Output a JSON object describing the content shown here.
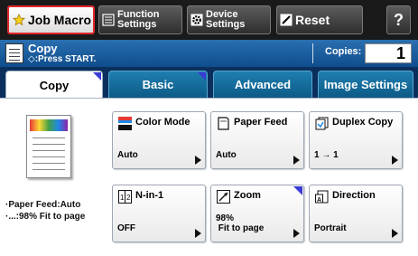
{
  "toolbar": {
    "job_macro": "Job Macro",
    "function_settings": [
      "Function",
      "Settings"
    ],
    "device_settings": [
      "Device",
      "Settings"
    ],
    "reset": "Reset",
    "help": "?"
  },
  "header": {
    "title": "Copy",
    "subtitle": "◇:Press START.",
    "copies_label": "Copies:",
    "copies_value": "1"
  },
  "tabs": [
    {
      "label": "Copy",
      "active": true
    },
    {
      "label": "Basic",
      "active": false
    },
    {
      "label": "Advanced",
      "active": false
    },
    {
      "label": "Image Settings",
      "active": false
    }
  ],
  "preview": {
    "line1": "·Paper Feed:Auto",
    "line2": "·...:98% Fit to page"
  },
  "functions": [
    {
      "name": "Color Mode",
      "value": "Auto",
      "icon": "color-mode-icon"
    },
    {
      "name": "Paper Feed",
      "value": "Auto",
      "icon": "paper-feed-icon"
    },
    {
      "name": "Duplex Copy",
      "value": "1 → 1",
      "icon": "duplex-copy-icon"
    },
    {
      "name": "N-in-1",
      "value": "OFF",
      "icon": "n-in-1-icon"
    },
    {
      "name": "Zoom",
      "value_line1": "98%",
      "value_line2": " Fit to page",
      "icon": "zoom-icon"
    },
    {
      "name": "Direction",
      "value": "Portrait",
      "icon": "direction-icon"
    }
  ],
  "colors": {
    "accent_border": "#e0262b",
    "tab_corner": "#3b3bd6",
    "header_blue": "#1a5c9f"
  }
}
